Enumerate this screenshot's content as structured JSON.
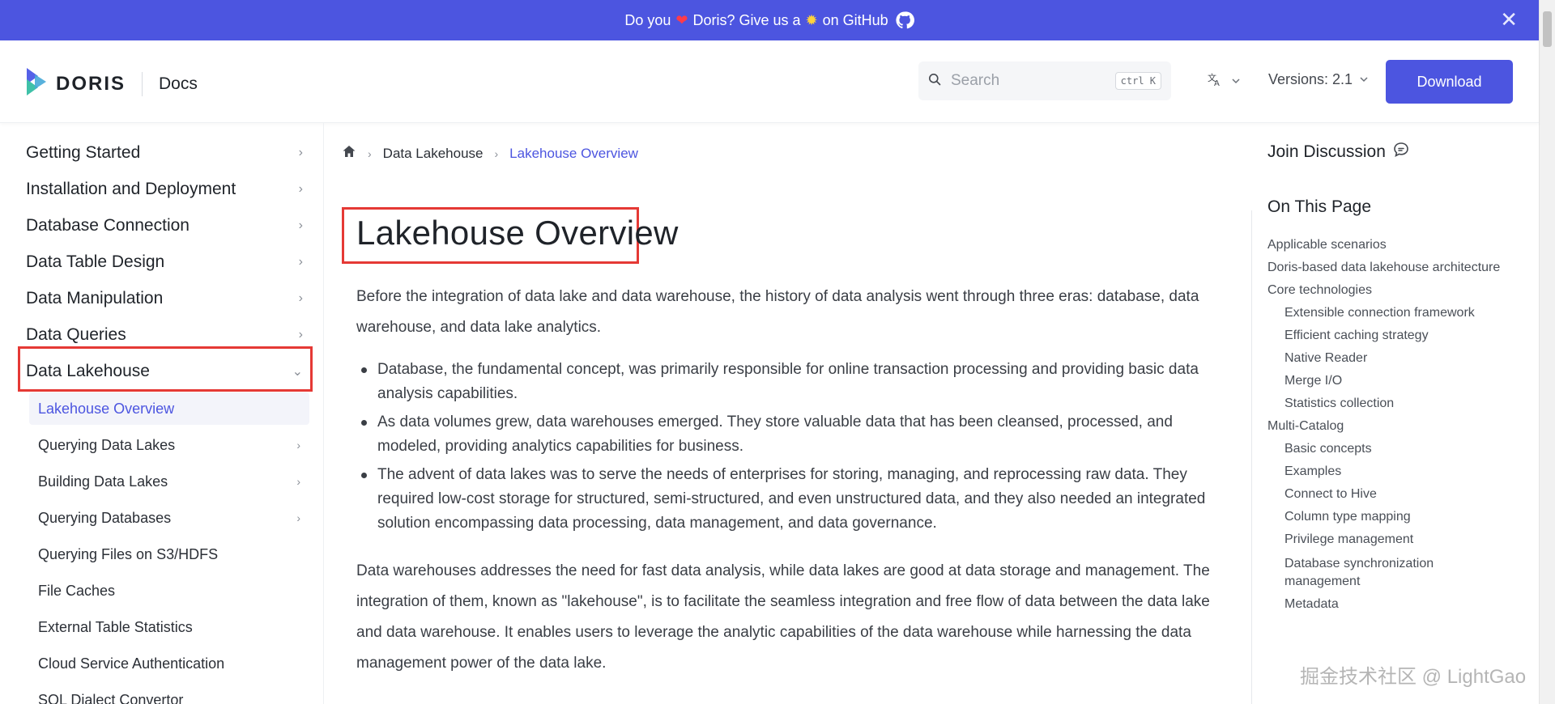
{
  "announcement": {
    "prefix": "Do you",
    "middle": "Doris? Give us a",
    "suffix": "on GitHub",
    "heart": "❤",
    "sun": "✹"
  },
  "navbar": {
    "brand": "DORIS",
    "docs": "Docs",
    "search_placeholder": "Search",
    "search_shortcut": "ctrl K",
    "versions": "Versions: 2.1",
    "download": "Download"
  },
  "sidebar": {
    "items": [
      {
        "label": "Getting Started"
      },
      {
        "label": "Installation and Deployment"
      },
      {
        "label": "Database Connection"
      },
      {
        "label": "Data Table Design"
      },
      {
        "label": "Data Manipulation"
      },
      {
        "label": "Data Queries"
      },
      {
        "label": "Data Lakehouse"
      }
    ],
    "subitems": [
      {
        "label": "Lakehouse Overview"
      },
      {
        "label": "Querying Data Lakes"
      },
      {
        "label": "Building Data Lakes"
      },
      {
        "label": "Querying Databases"
      },
      {
        "label": "Querying Files on S3/HDFS"
      },
      {
        "label": "File Caches"
      },
      {
        "label": "External Table Statistics"
      },
      {
        "label": "Cloud Service Authentication"
      },
      {
        "label": "SQL Dialect Convertor"
      }
    ]
  },
  "breadcrumb": {
    "section": "Data Lakehouse",
    "current": "Lakehouse Overview"
  },
  "content": {
    "title": "Lakehouse Overview",
    "intro": "Before the integration of data lake and data warehouse, the history of data analysis went through three eras: database, data warehouse, and data lake analytics.",
    "bullets": [
      "Database, the fundamental concept, was primarily responsible for online transaction processing and providing basic data analysis capabilities.",
      "As data volumes grew, data warehouses emerged. They store valuable data that has been cleansed, processed, and modeled, providing analytics capabilities for business.",
      "The advent of data lakes was to serve the needs of enterprises for storing, managing, and reprocessing raw data. They required low-cost storage for structured, semi-structured, and even unstructured data, and they also needed an integrated solution encompassing data processing, data management, and data governance."
    ],
    "closing": "Data warehouses addresses the need for fast data analysis, while data lakes are good at data storage and management. The integration of them, known as \"lakehouse\", is to facilitate the seamless integration and free flow of data between the data lake and data warehouse. It enables users to leverage the analytic capabilities of the data warehouse while harnessing the data management power of the data lake."
  },
  "toc": {
    "join": "Join Discussion",
    "heading": "On This Page",
    "items": [
      {
        "label": "Applicable scenarios"
      },
      {
        "label": "Doris-based data lakehouse architecture"
      },
      {
        "label": "Core technologies"
      },
      {
        "label": "Extensible connection framework"
      },
      {
        "label": "Efficient caching strategy"
      },
      {
        "label": "Native Reader"
      },
      {
        "label": "Merge I/O"
      },
      {
        "label": "Statistics collection"
      },
      {
        "label": "Multi-Catalog"
      },
      {
        "label": "Basic concepts"
      },
      {
        "label": "Examples"
      },
      {
        "label": "Connect to Hive"
      },
      {
        "label": "Column type mapping"
      },
      {
        "label": "Privilege management"
      },
      {
        "label": "Database synchronization management"
      },
      {
        "label": "Metadata"
      }
    ]
  },
  "watermark": "掘金技术社区 @ LightGao"
}
